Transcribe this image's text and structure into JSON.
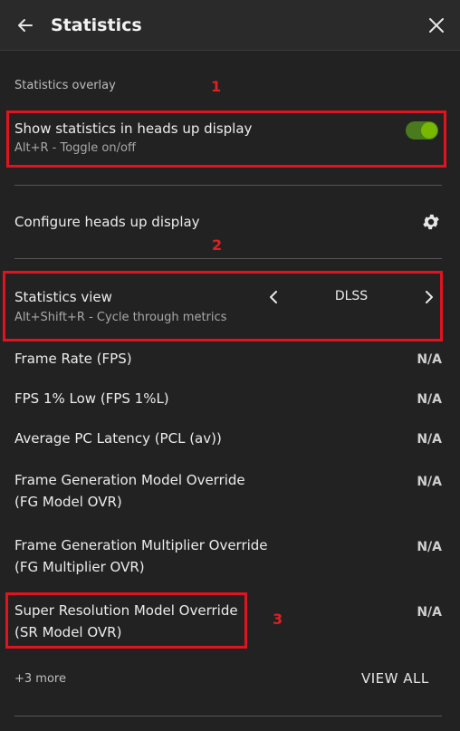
{
  "header": {
    "title": "Statistics",
    "back_icon": "arrow-left-icon",
    "close_icon": "close-icon"
  },
  "overlay_section": {
    "label": "Statistics overlay"
  },
  "annotations": [
    "1",
    "2",
    "3"
  ],
  "hud_toggle": {
    "title": "Show statistics in heads up display",
    "subtitle": "Alt+R - Toggle on/off",
    "enabled": true,
    "accent_color": "#76b900"
  },
  "configure": {
    "label": "Configure heads up display",
    "icon": "gear-icon"
  },
  "stats_view": {
    "title": "Statistics view",
    "subtitle": "Alt+Shift+R - Cycle through metrics",
    "value": "DLSS"
  },
  "metrics": [
    {
      "name": "Frame Rate (FPS)",
      "value": "N/A"
    },
    {
      "name": "FPS 1% Low (FPS 1%L)",
      "value": "N/A"
    },
    {
      "name": "Average PC Latency (PCL (av))",
      "value": "N/A"
    },
    {
      "name_line1": "Frame Generation Model Override",
      "name_line2": "(FG Model OVR)",
      "value": "N/A"
    },
    {
      "name_line1": "Frame Generation Multiplier Override",
      "name_line2": "(FG Multiplier OVR)",
      "value": "N/A"
    },
    {
      "name_line1": "Super Resolution Model Override",
      "name_line2": "(SR Model OVR)",
      "value": "N/A"
    }
  ],
  "footer": {
    "more": "+3 more",
    "view_all": "VIEW ALL"
  },
  "colors": {
    "background": "#222222",
    "highlight_box": "#e0141e"
  }
}
